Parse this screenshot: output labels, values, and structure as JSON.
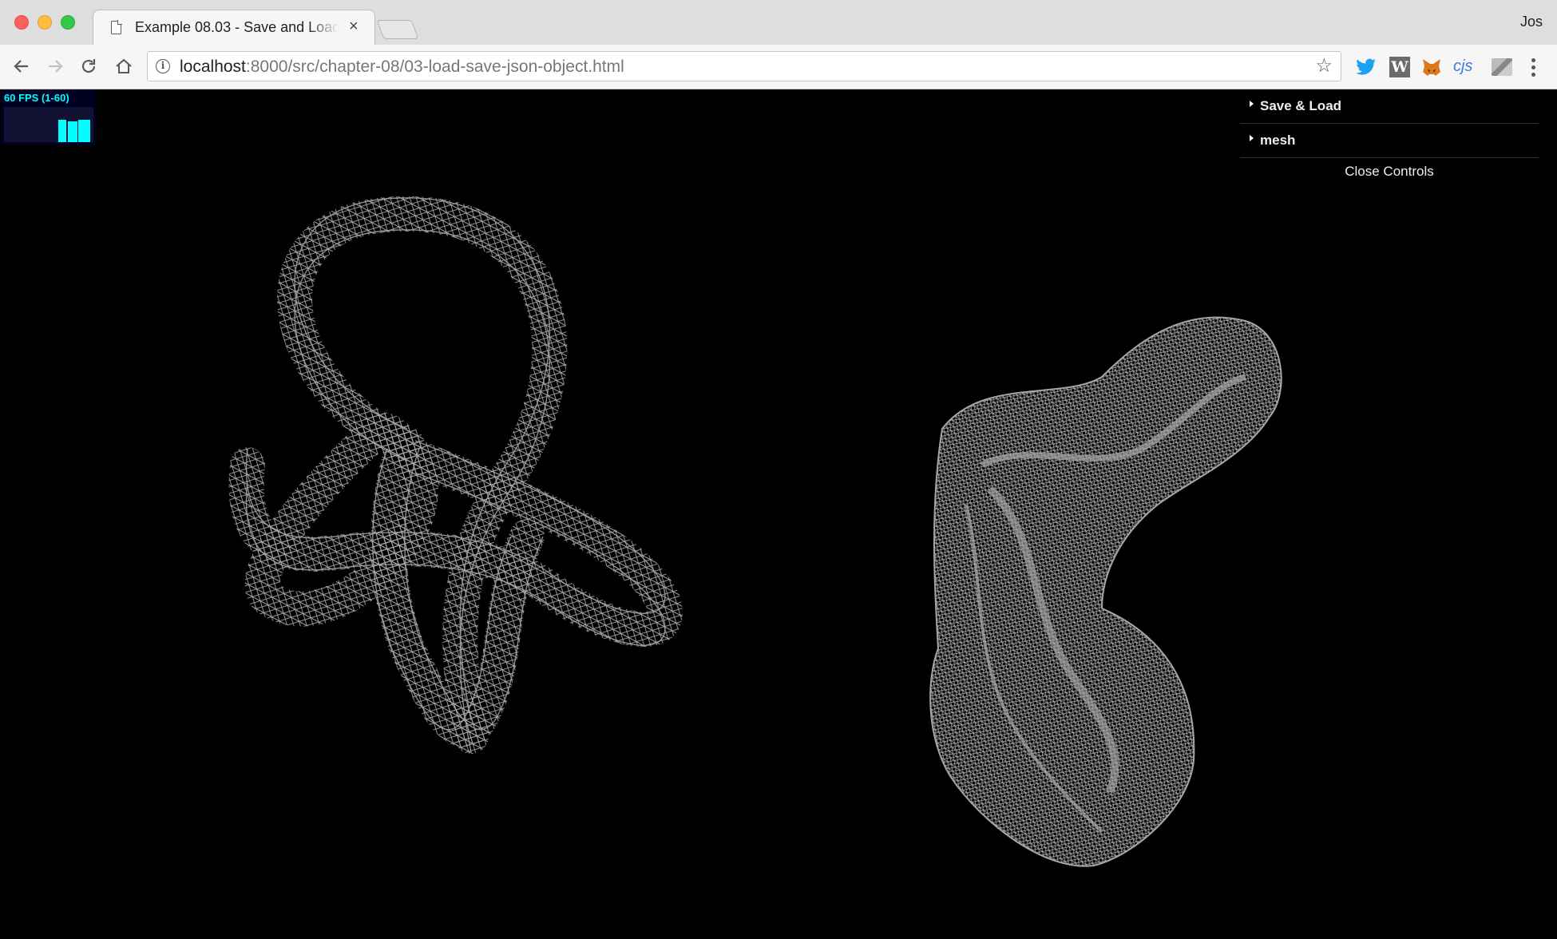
{
  "browser": {
    "tab": {
      "title": "Example 08.03 - Save and Load"
    },
    "profile_name": "Jos",
    "url": {
      "host": "localhost",
      "rest": ":8000/src/chapter-08/03-load-save-json-object.html"
    },
    "extensions": [
      "twitter-icon",
      "w-icon",
      "metamask-fox-icon",
      "cjs-icon",
      "image-ext-icon"
    ],
    "ext_w_label": "W",
    "ext_cjs_label": "cjs"
  },
  "stats": {
    "fps_text": "60 FPS (1-60)"
  },
  "gui": {
    "folders": [
      {
        "label": "Save & Load"
      },
      {
        "label": "mesh"
      }
    ],
    "close_label": "Close Controls"
  },
  "colors": {
    "wireframe": "#a6a6a6",
    "stats_fg": "#00ffff",
    "stats_bg": "#000022"
  }
}
